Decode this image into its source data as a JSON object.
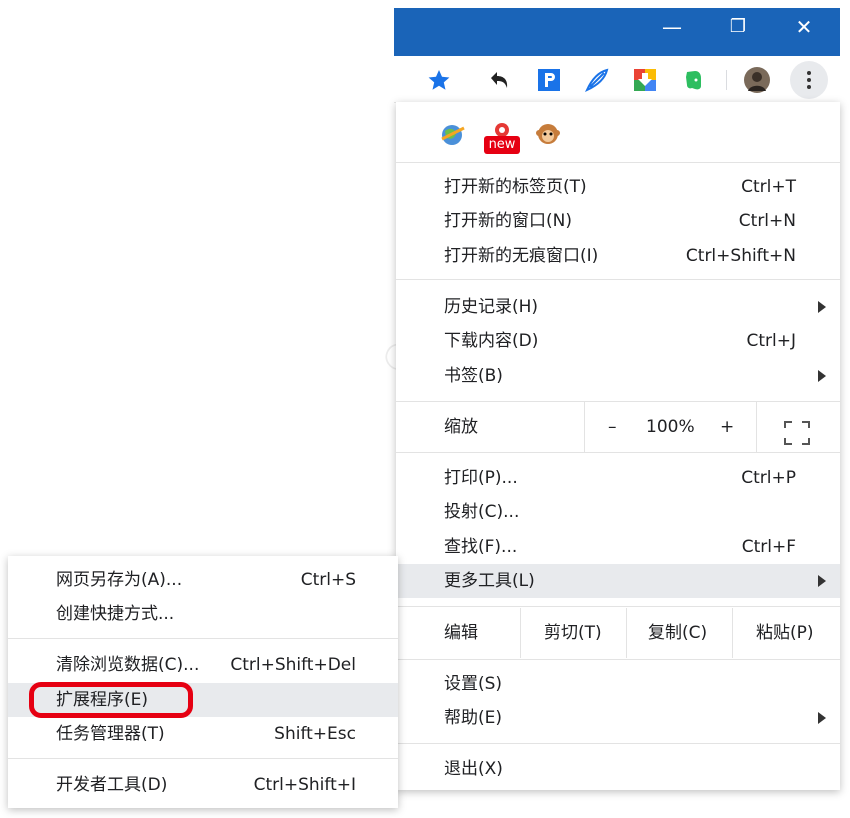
{
  "window": {
    "minimize_glyph": "—",
    "restore_glyph": "❐",
    "close_glyph": "✕"
  },
  "toolbar": {
    "icons": [
      "bookmark-star-icon",
      "history-back-icon",
      "pocket-p-icon",
      "feather-icon",
      "download-icon",
      "evernote-icon",
      "avatar",
      "more-menu-icon"
    ]
  },
  "extensions_row": {
    "badge": "new"
  },
  "menu": {
    "new_tab": {
      "label": "打开新的标签页(T)",
      "shortcut": "Ctrl+T"
    },
    "new_window": {
      "label": "打开新的窗口(N)",
      "shortcut": "Ctrl+N"
    },
    "incognito": {
      "label": "打开新的无痕窗口(I)",
      "shortcut": "Ctrl+Shift+N"
    },
    "history": {
      "label": "历史记录(H)"
    },
    "downloads": {
      "label": "下载内容(D)",
      "shortcut": "Ctrl+J"
    },
    "bookmarks": {
      "label": "书签(B)"
    },
    "zoom": {
      "label": "缩放",
      "minus": "–",
      "value": "100%",
      "plus": "+"
    },
    "print": {
      "label": "打印(P)...",
      "shortcut": "Ctrl+P"
    },
    "cast": {
      "label": "投射(C)..."
    },
    "find": {
      "label": "查找(F)...",
      "shortcut": "Ctrl+F"
    },
    "more_tools": {
      "label": "更多工具(L)"
    },
    "edit": {
      "label": "编辑",
      "cut": "剪切(T)",
      "copy": "复制(C)",
      "paste": "粘贴(P)"
    },
    "settings": {
      "label": "设置(S)"
    },
    "help": {
      "label": "帮助(E)"
    },
    "exit": {
      "label": "退出(X)"
    }
  },
  "submenu": {
    "save_page": {
      "label": "网页另存为(A)...",
      "shortcut": "Ctrl+S"
    },
    "create_shortcut": {
      "label": "创建快捷方式..."
    },
    "clear_data": {
      "label": "清除浏览数据(C)...",
      "shortcut": "Ctrl+Shift+Del"
    },
    "extensions": {
      "label": "扩展程序(E)"
    },
    "task_manager": {
      "label": "任务管理器(T)",
      "shortcut": "Shift+Esc"
    },
    "dev_tools": {
      "label": "开发者工具(D)",
      "shortcut": "Ctrl+Shift+I"
    }
  },
  "colors": {
    "titlebar": "#1a64b8",
    "highlight": "#e8eaed",
    "red_box": "#e60012"
  }
}
